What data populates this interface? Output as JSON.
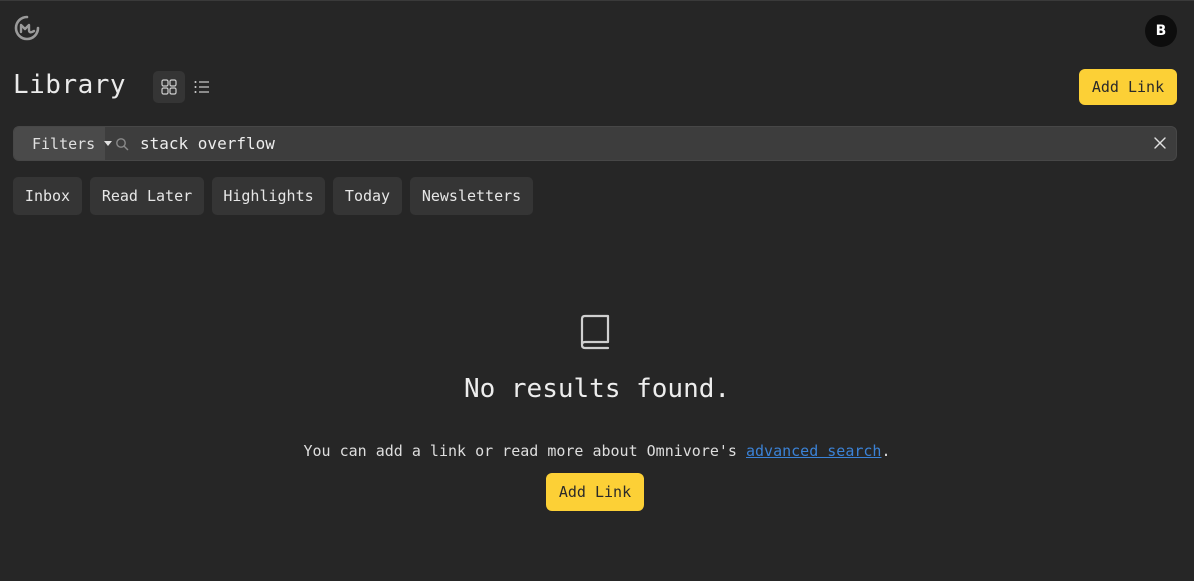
{
  "header": {
    "logo_icon": "omnivore-logo-icon",
    "avatar_initial": "B"
  },
  "library": {
    "title": "Library",
    "add_link_label": "Add Link"
  },
  "search": {
    "filters_label": "Filters",
    "query": "stack overflow"
  },
  "chips": [
    {
      "label": "Inbox"
    },
    {
      "label": "Read Later"
    },
    {
      "label": "Highlights"
    },
    {
      "label": "Today"
    },
    {
      "label": "Newsletters"
    }
  ],
  "empty_state": {
    "icon": "book-icon",
    "title": "No results found.",
    "message_prefix": "You can add a link or read more about Omnivore's ",
    "link_text": "advanced search",
    "message_suffix": ".",
    "add_link_label": "Add Link"
  },
  "colors": {
    "background": "#262626",
    "accent": "#fcd036",
    "link": "#3b82d6"
  }
}
